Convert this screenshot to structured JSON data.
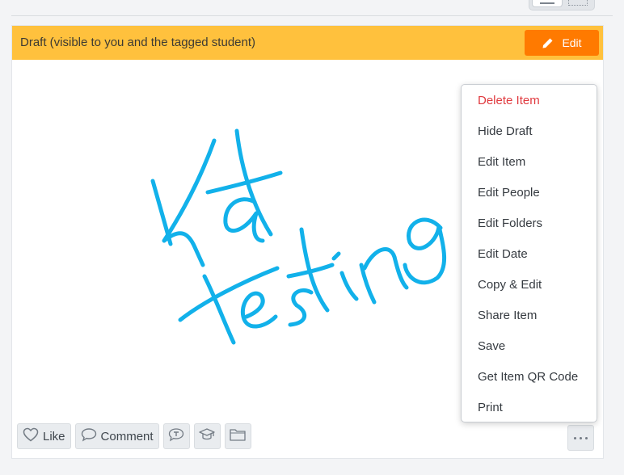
{
  "draft_banner": {
    "text": "Draft (visible to you and the tagged student)",
    "edit_label": "Edit",
    "background": "#ffc13d",
    "button_color": "#ff7a00"
  },
  "drawing": {
    "handwritten_text": "Kat Testing",
    "ink_color": "#12b1ea"
  },
  "actions": {
    "like_label": "Like",
    "comment_label": "Comment",
    "icons": [
      "heart-icon",
      "comment-icon",
      "translate-icon",
      "graduation-cap-icon",
      "folder-icon"
    ]
  },
  "more_menu": {
    "items": [
      {
        "label": "Delete Item",
        "color": "#e0393e"
      },
      {
        "label": "Hide Draft"
      },
      {
        "label": "Edit Item"
      },
      {
        "label": "Edit People"
      },
      {
        "label": "Edit Folders"
      },
      {
        "label": "Edit Date"
      },
      {
        "label": "Copy & Edit"
      },
      {
        "label": "Share Item"
      },
      {
        "label": "Save"
      },
      {
        "label": "Get Item QR Code"
      },
      {
        "label": "Print"
      }
    ]
  }
}
